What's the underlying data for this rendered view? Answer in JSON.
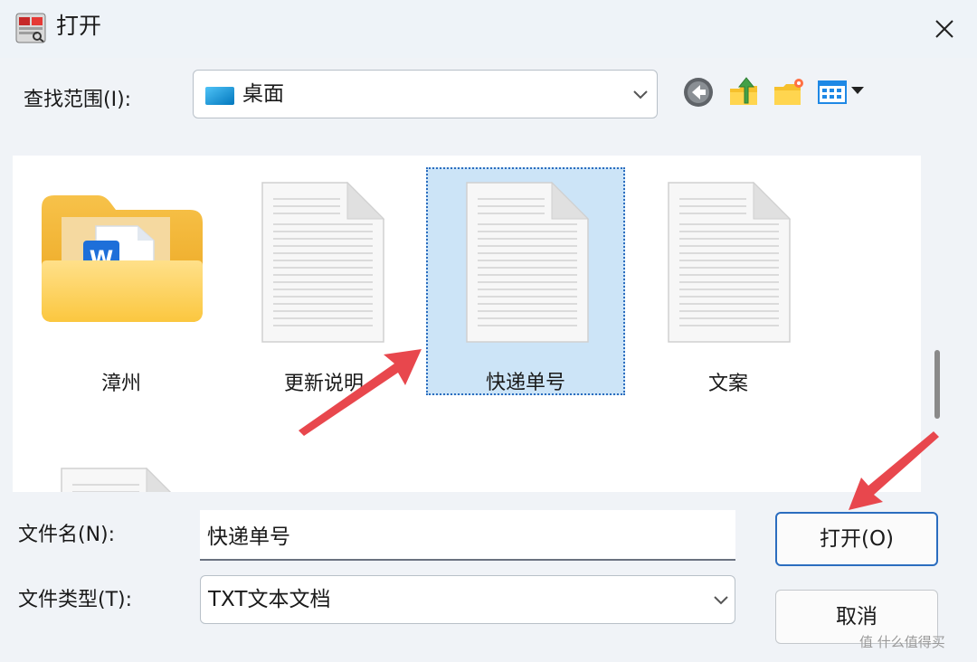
{
  "window": {
    "title": "打开",
    "close_icon": "close-icon"
  },
  "lookin": {
    "label": "查找范围(I):",
    "value": "桌面",
    "icon": "desktop-icon"
  },
  "toolbar": {
    "buttons": [
      "back-icon",
      "up-folder-icon",
      "new-folder-icon",
      "view-menu-icon"
    ]
  },
  "files": [
    {
      "name": "漳州",
      "type": "folder"
    },
    {
      "name": "更新说明",
      "type": "document"
    },
    {
      "name": "快递单号",
      "type": "document",
      "selected": true
    },
    {
      "name": "文案",
      "type": "document"
    },
    {
      "name": "",
      "type": "document"
    }
  ],
  "filename": {
    "label": "文件名(N):",
    "value": "快递单号"
  },
  "filetype": {
    "label": "文件类型(T):",
    "value": "TXT文本文档"
  },
  "buttons": {
    "open": "打开(O)",
    "cancel": "取消"
  },
  "watermark": "值 什么值得买",
  "colors": {
    "selection": "#cce4f7",
    "accent": "#2b6dbf",
    "arrow": "#e8474d"
  }
}
